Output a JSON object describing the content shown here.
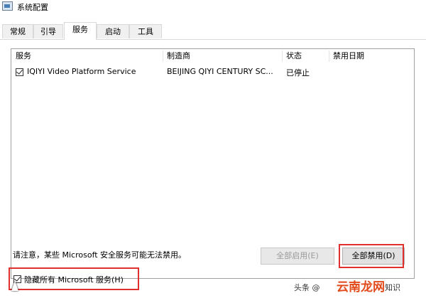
{
  "window": {
    "title": "系统配置"
  },
  "tabs": [
    {
      "label": "常规"
    },
    {
      "label": "引导"
    },
    {
      "label": "服务",
      "active": true
    },
    {
      "label": "启动"
    },
    {
      "label": "工具"
    }
  ],
  "services_table": {
    "columns": [
      "服务",
      "制造商",
      "状态",
      "禁用日期"
    ],
    "rows": [
      {
        "checked": true,
        "service": "IQIYI Video Platform Service",
        "manufacturer": "BEIJING QIYI CENTURY SC...",
        "status": "已停止",
        "disabled_date": ""
      }
    ]
  },
  "note": "请注意，某些 Microsoft 安全服务可能无法禁用。",
  "buttons": {
    "enable_all": "全部启用(E)",
    "disable_all": "全部禁用(D)"
  },
  "hide_ms": {
    "label": "隐藏所有 Microsoft 服务(H)",
    "checked": true
  },
  "watermark": {
    "prefix": "头条 @",
    "brand": "云南龙网",
    "suffix": "知识"
  },
  "colors": {
    "highlight_box": "#e0302e",
    "watermark_brand": "#e24a1a"
  }
}
